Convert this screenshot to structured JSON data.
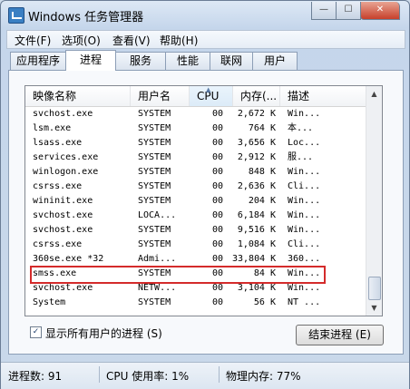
{
  "window": {
    "title": "Windows 任务管理器"
  },
  "menubar": {
    "items": [
      "文件(F)",
      "选项(O)",
      "查看(V)",
      "帮助(H)"
    ]
  },
  "tabs": [
    "应用程序",
    "进程",
    "服务",
    "性能",
    "联网",
    "用户"
  ],
  "active_tab": "进程",
  "table": {
    "headers": [
      "映像名称",
      "用户名",
      "CPU",
      "内存(...",
      "描述"
    ],
    "rows": [
      [
        "svchost.exe",
        "SYSTEM",
        "00",
        "2,672 K",
        "Win..."
      ],
      [
        "lsm.exe",
        "SYSTEM",
        "00",
        "764 K",
        "本..."
      ],
      [
        "lsass.exe",
        "SYSTEM",
        "00",
        "3,656 K",
        "Loc..."
      ],
      [
        "services.exe",
        "SYSTEM",
        "00",
        "2,912 K",
        "服..."
      ],
      [
        "winlogon.exe",
        "SYSTEM",
        "00",
        "848 K",
        "Win..."
      ],
      [
        "csrss.exe",
        "SYSTEM",
        "00",
        "2,636 K",
        "Cli..."
      ],
      [
        "wininit.exe",
        "SYSTEM",
        "00",
        "204 K",
        "Win..."
      ],
      [
        "svchost.exe",
        "LOCA...",
        "00",
        "6,184 K",
        "Win..."
      ],
      [
        "svchost.exe",
        "SYSTEM",
        "00",
        "9,516 K",
        "Win..."
      ],
      [
        "csrss.exe",
        "SYSTEM",
        "00",
        "1,084 K",
        "Cli..."
      ],
      [
        "360se.exe *32",
        "Admi...",
        "00",
        "33,804 K",
        "360..."
      ],
      [
        "smss.exe",
        "SYSTEM",
        "00",
        "84 K",
        "Win..."
      ],
      [
        "svchost.exe",
        "NETW...",
        "00",
        "3,104 K",
        "Win..."
      ],
      [
        "System",
        "SYSTEM",
        "00",
        "56 K",
        "NT ..."
      ]
    ],
    "highlighted_row_index": 11
  },
  "show_all_users": {
    "label": "显示所有用户的进程 (S)",
    "checked": true,
    "mark": "✓"
  },
  "end_process_button": "结束进程 (E)",
  "statusbar": {
    "process_count": "进程数: 91",
    "cpu_usage": "CPU 使用率: 1%",
    "physical_memory": "物理内存: 77%"
  },
  "titlebar_controls": {
    "minimize": "—",
    "maximize": "☐",
    "close": "✕"
  },
  "scrollbar": {
    "up": "▲",
    "down": "▼"
  },
  "sort_indicator": "▲",
  "colors": {
    "highlight_border": "#d42b2b",
    "window_bg": "#c9d8ea"
  }
}
